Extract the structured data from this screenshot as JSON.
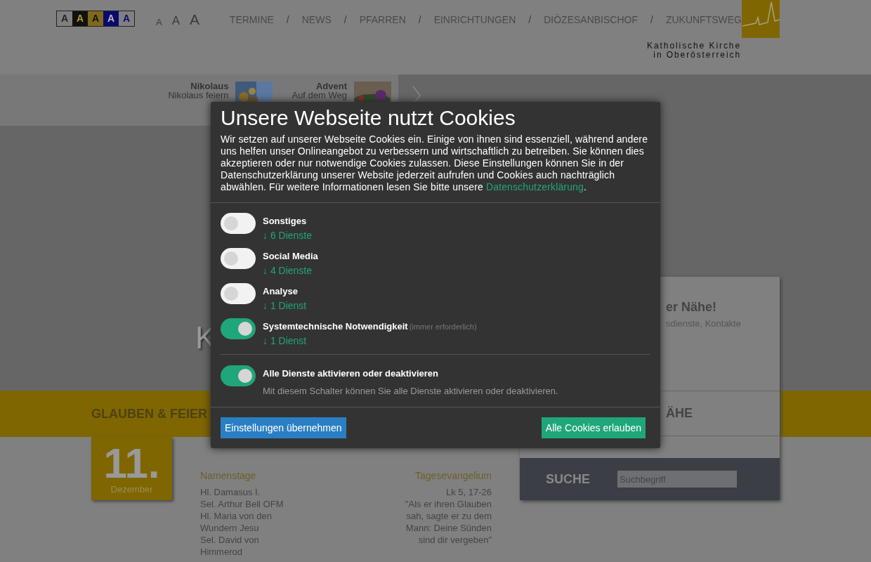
{
  "contrast_options": [
    {
      "label": "A",
      "kind": "normal"
    },
    {
      "label": "A",
      "kind": "dark"
    },
    {
      "label": "A",
      "kind": "yellow"
    },
    {
      "label": "A",
      "kind": "blue"
    },
    {
      "label": "A",
      "kind": "inverse"
    }
  ],
  "font_sizes": [
    {
      "label": "A",
      "kind": "small"
    },
    {
      "label": "A",
      "kind": "medium"
    },
    {
      "label": "A",
      "kind": "large"
    }
  ],
  "nav": [
    {
      "kind": "link",
      "label": "TERMINE"
    },
    {
      "kind": "separator",
      "label": "/"
    },
    {
      "kind": "link",
      "label": "NEWS"
    },
    {
      "kind": "separator",
      "label": "/"
    },
    {
      "kind": "link",
      "label": "PFARREN"
    },
    {
      "kind": "separator",
      "label": "/"
    },
    {
      "kind": "link",
      "label": "EINRICHTUNGEN"
    },
    {
      "kind": "separator",
      "label": "/"
    },
    {
      "kind": "link",
      "label": "DIÖZESANBISCHOF"
    },
    {
      "kind": "separator",
      "label": "/"
    },
    {
      "kind": "link",
      "label": "ZUKUNFTSWEG"
    }
  ],
  "logo": {
    "lines": [
      "Katholische Kirche",
      "in Oberösterreich"
    ]
  },
  "teasers": [
    {
      "title": "Nikolaus",
      "subtitle": "Nikolaus feiern"
    },
    {
      "title": "Advent",
      "subtitle": "Auf dem Weg"
    }
  ],
  "hero": {
    "heading": "K"
  },
  "nearby_card": {
    "title": "er Nähe!",
    "subtitle": "sdienste, Kontakte",
    "section": "ÄHE"
  },
  "band": {
    "title": "GLAUBEN & FEIER"
  },
  "date": {
    "day": "11.",
    "month": "Dezember"
  },
  "namenstage": {
    "heading": "Namenstage",
    "names": [
      "Hl. Damasus I.",
      "Sel. Arthur Bell OFM",
      "Hl. Maria von den Wundern Jesu",
      "Sel. David von Himmerod"
    ]
  },
  "evangelium": {
    "heading": "Tagesevangelium",
    "reference": "Lk 5, 17-26",
    "quote": "\"Als er ihren Glauben sah, sagte er zu dem Mann: Deine Sünden sind dir vergeben\""
  },
  "search": {
    "label": "SUCHE",
    "placeholder": "Suchbegriff"
  },
  "cookie_dialog": {
    "title": "Unsere Webseite nutzt Cookies",
    "text": "Wir setzen auf unserer Webseite Cookies ein. Einige von ihnen sind essenziell, während andere uns helfen unser Onlineangebot zu verbessern und wirtschaftlich zu betreiben. Sie können dies akzeptieren oder nur notwendige Cookies zulassen. Diese Einstellungen können Sie in der Datenschutzerklärung unserer Website jederzeit aufrufen und Cookies auch nachträglich abwählen. Für weitere Informationen lesen Sie bitte unsere",
    "link": "Datenschutzerklärung",
    "text_end": ".",
    "categories": [
      {
        "name": "Sonstiges",
        "services": "↓ 6 Dienste",
        "on": false
      },
      {
        "name": "Social Media",
        "services": "↓ 4 Dienste",
        "on": false
      },
      {
        "name": "Analyse",
        "services": "↓ 1 Dienst",
        "on": false
      },
      {
        "name": "Systemtechnische Notwendigkeit",
        "note": "(immer erforderlich)",
        "services": "↓ 1 Dienst",
        "on": true
      }
    ],
    "master": {
      "label": "Alle Dienste aktivieren oder deaktivieren",
      "description": "Mit diesem Schalter können Sie alle Dienste aktivieren oder deaktivieren.",
      "on": true
    },
    "buttons": {
      "settings": "Einstellungen übernehmen",
      "accept": "Alle Cookies erlauben"
    }
  }
}
